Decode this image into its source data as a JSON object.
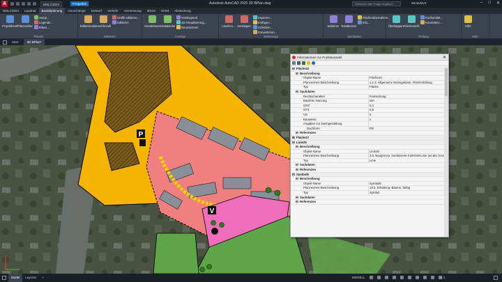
{
  "titlebar": {
    "app_letter": "A",
    "workspace": "WSLC2024",
    "share": "Freigeben",
    "title": "Autodesk AutoCAD 2025   3D BPlan.dwg",
    "search_placeholder": "Stichwort oder Frage eingeben",
    "user": "WinterBV2",
    "min": "–",
    "max": "□",
    "close": "✕"
  },
  "tabs": [
    "WSLC2024",
    "Landrad",
    "Bauleitplanung",
    "Geoschange",
    "Entwurf",
    "Verkehr",
    "Vermessung",
    "3Dwin",
    "DiXM",
    "Absteckung"
  ],
  "active_tab": "Bauleitplanung",
  "ribbon": {
    "groups": [
      {
        "title": "Plan2D",
        "buttons": [
          "Projektfenster...",
          "Planzeichenmanager...",
          "Setup...",
          "Legende...",
          "Bilanz..."
        ]
      },
      {
        "title": "Editieren",
        "buttons": [
          "Editiermodus",
          "Insel hinzufügen",
          "Grafik editieren...",
          "Editieren"
        ]
      },
      {
        "title": "Anzeige",
        "buttons": [
          "Sonderbereich",
          "Inselabschnitt ausblenden",
          "Vordergrund",
          "3D-Visualisierung...",
          "Neuzeichnen"
        ]
      },
      {
        "title": "Werkzeuge",
        "buttons": [
          "Löschen...",
          "Versteigen",
          "Kopieren...",
          "Einfügen...",
          "Schieben...",
          "Konvertieren..."
        ]
      },
      {
        "title": "Sachdaten",
        "buttons": [
          "Editieren",
          "Textübernahme...",
          "Flächenübernahme...",
          "Info..."
        ]
      },
      {
        "title": "Prüfung",
        "buttons": [
          "Überlappung",
          "Flächenschluss...",
          "Konformität...",
          "Konsistenz..."
        ]
      },
      {
        "title": "Hilfe",
        "buttons": [
          "Hilfe"
        ]
      }
    ]
  },
  "doctabs": [
    "Start",
    "3D BPlan*"
  ],
  "active_doctab": "3D BPlan*",
  "map": {
    "markers": [
      "P",
      "V"
    ]
  },
  "info_panel": {
    "title": "Informationen zur Punktauswahl",
    "rows": [
      {
        "level": 0,
        "key": "Fläche10",
        "value": "",
        "head": true
      },
      {
        "level": 1,
        "key": "Beschreibung",
        "value": "",
        "head": true
      },
      {
        "level": 2,
        "key": "Objekt-Name",
        "value": "Fläche10"
      },
      {
        "level": 2,
        "key": "Planzeichen-Beschreibung",
        "value": "1.1.3. Allgemeine Wohngebiete, Flächenfüllung"
      },
      {
        "level": 2,
        "key": "Typ",
        "value": "Fläche"
      },
      {
        "level": 1,
        "key": "Sachdaten",
        "value": "",
        "head": true
      },
      {
        "level": 2,
        "key": "Rechtscharakter",
        "value": "Festsetzung"
      },
      {
        "level": 2,
        "key": "Bauliche Nutzung",
        "value": "WA"
      },
      {
        "level": 2,
        "key": "GRZ",
        "value": "0,4"
      },
      {
        "level": 2,
        "key": "GFZ",
        "value": "0,8"
      },
      {
        "level": 2,
        "key": "VG",
        "value": "II"
      },
      {
        "level": 2,
        "key": "Bauweise",
        "value": "o"
      },
      {
        "level": 2,
        "key": "Angaben zur Dachgestaltung",
        "value": ""
      },
      {
        "level": 3,
        "key": "Dachform",
        "value": "PD"
      },
      {
        "level": 1,
        "key": "Referenzen",
        "value": "",
        "head": true
      },
      {
        "level": 0,
        "key": "Fläche17",
        "value": "",
        "head": true
      },
      {
        "level": 0,
        "key": "Linie25",
        "value": "",
        "head": true
      },
      {
        "level": 1,
        "key": "Beschreibung",
        "value": "",
        "head": true
      },
      {
        "level": 2,
        "key": "Objekt-Name",
        "value": "Linie25"
      },
      {
        "level": 2,
        "key": "Planzeichen-Beschreibung",
        "value": "3.5. Baugrenze, kombinierte Farb/SW-Linie (an der Grun"
      },
      {
        "level": 2,
        "key": "Typ",
        "value": "Linie"
      },
      {
        "level": 1,
        "key": "Sachdaten",
        "value": "",
        "head": true
      },
      {
        "level": 1,
        "key": "Referenzen",
        "value": "",
        "head": true
      },
      {
        "level": 0,
        "key": "Symbol5",
        "value": "",
        "head": true
      },
      {
        "level": 1,
        "key": "Beschreibung",
        "value": "",
        "head": true
      },
      {
        "level": 2,
        "key": "Objekt-Name",
        "value": "Symbol5"
      },
      {
        "level": 2,
        "key": "Planzeichen-Beschreibung",
        "value": "13.2. Erhaltung: Bäume, farbig"
      },
      {
        "level": 2,
        "key": "Typ",
        "value": "Symbol"
      },
      {
        "level": 1,
        "key": "Sachdaten",
        "value": "",
        "head": true
      },
      {
        "level": 1,
        "key": "Referenzen",
        "value": "",
        "head": true
      }
    ]
  },
  "statusbar": {
    "layouts": [
      "Model",
      "Layout1"
    ],
    "active_layout": "Model",
    "add": "+",
    "mode": "MODELL",
    "zoom": "1:1"
  },
  "colors": {
    "ribbon": "#3b4350",
    "residential": "#f07f7f",
    "road": "#f5b400",
    "green": "#5fa64a",
    "pink": "#f06dbb"
  }
}
